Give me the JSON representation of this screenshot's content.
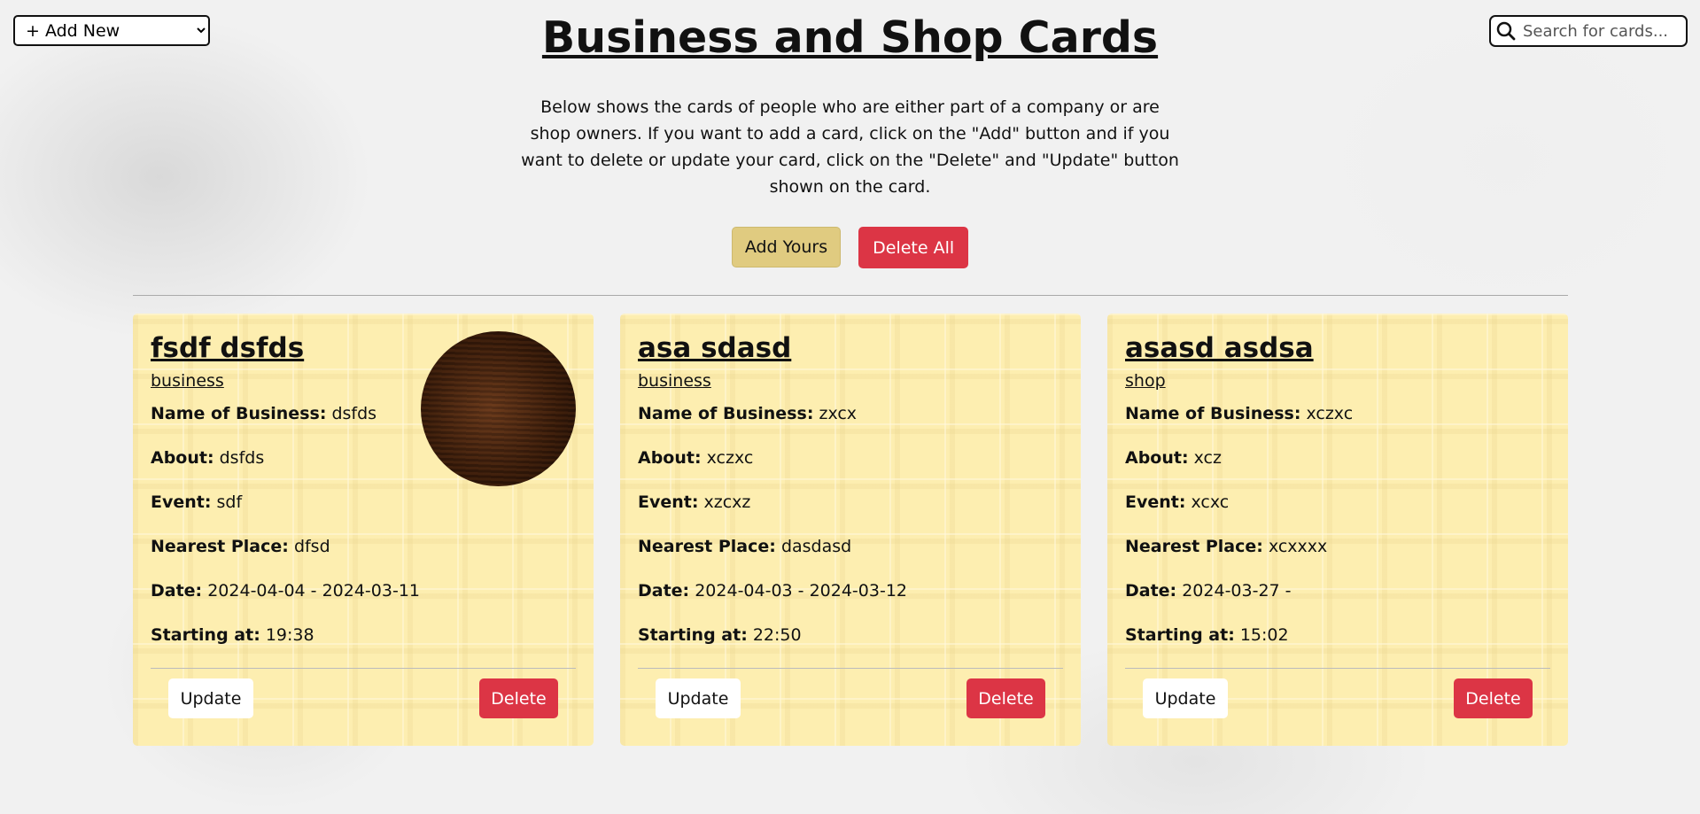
{
  "header": {
    "add_select_label": "+ Add New",
    "title": "Business and Shop Cards",
    "intro": "Below shows the cards of people who are either part of a company or are shop owners. If you want to add a card, click on the \"Add\" button and if you want to delete or update your card, click on the \"Delete\" and \"Update\" button shown on the card.",
    "search_placeholder": "Search for cards...",
    "add_yours_label": "Add Yours",
    "delete_all_label": "Delete All"
  },
  "labels": {
    "business_name": "Name of Business:",
    "about": "About:",
    "event": "Event:",
    "nearest_place": "Nearest Place:",
    "date": "Date:",
    "starting_at": "Starting at:",
    "update": "Update",
    "delete": "Delete"
  },
  "cards": [
    {
      "name": "fsdf dsfds",
      "type": "business",
      "business_name": "dsfds",
      "about": "dsfds",
      "event": "sdf",
      "nearest_place": "dfsd",
      "date": "2024-04-04 - 2024-03-11",
      "starting_at": "19:38"
    },
    {
      "name": "asa sdasd",
      "type": "business",
      "business_name": "zxcx",
      "about": "xczxc",
      "event": "xzcxz",
      "nearest_place": "dasdasd",
      "date": "2024-04-03 - 2024-03-12",
      "starting_at": "22:50"
    },
    {
      "name": "asasd asdsa",
      "type": "shop",
      "business_name": "xczxc",
      "about": "xcz",
      "event": "xcxc",
      "nearest_place": "xcxxxx",
      "date": "2024-03-27 -",
      "starting_at": "15:02"
    }
  ],
  "colors": {
    "add_button": "#e0cb80",
    "danger": "#dc3545",
    "card": "#fdeeb0"
  },
  "icons": {
    "search": "search-icon"
  }
}
